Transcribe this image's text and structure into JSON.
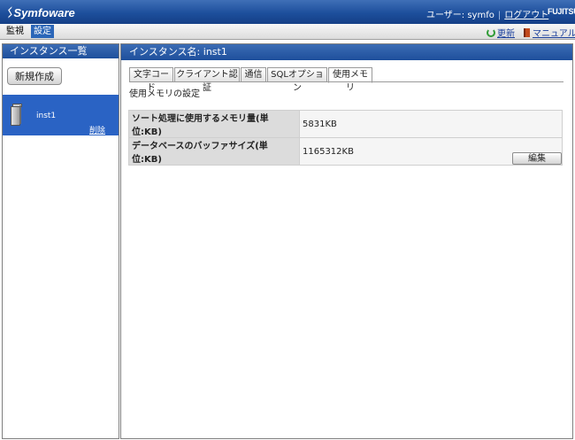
{
  "header": {
    "app_name": "Symfoware",
    "user_label": "ユーザー: symfo",
    "separator": "|",
    "logout": "ログアウト",
    "brand": "FUJITSU"
  },
  "menu": {
    "items": [
      {
        "label": "監視",
        "active": false
      },
      {
        "label": "設定",
        "active": true
      }
    ],
    "refresh": "更新",
    "manual": "マニュアル"
  },
  "sidebar": {
    "title": "インスタンス一覧",
    "new_button": "新規作成",
    "instances": [
      {
        "name": "inst1",
        "delete_label": "削除"
      }
    ]
  },
  "main": {
    "title": "インスタンス名: inst1",
    "tabs": [
      {
        "label": "文字コード",
        "selected": false
      },
      {
        "label": "クライアント認証",
        "selected": false
      },
      {
        "label": "通信",
        "selected": false
      },
      {
        "label": "SQLオプション",
        "selected": false
      },
      {
        "label": "使用メモリ",
        "selected": true
      }
    ],
    "section_title": "使用メモリの設定",
    "rows": [
      {
        "key": "ソート処理に使用するメモリ量(単位:KB)",
        "value": "5831KB"
      },
      {
        "key": "データベースのバッファサイズ(単位:KB)",
        "value": "1165312KB"
      }
    ],
    "edit_button": "編集"
  },
  "colors": {
    "header_blue": "#1d4f9c",
    "selected_item": "#2a63c4",
    "link": "#1a3f9c"
  }
}
